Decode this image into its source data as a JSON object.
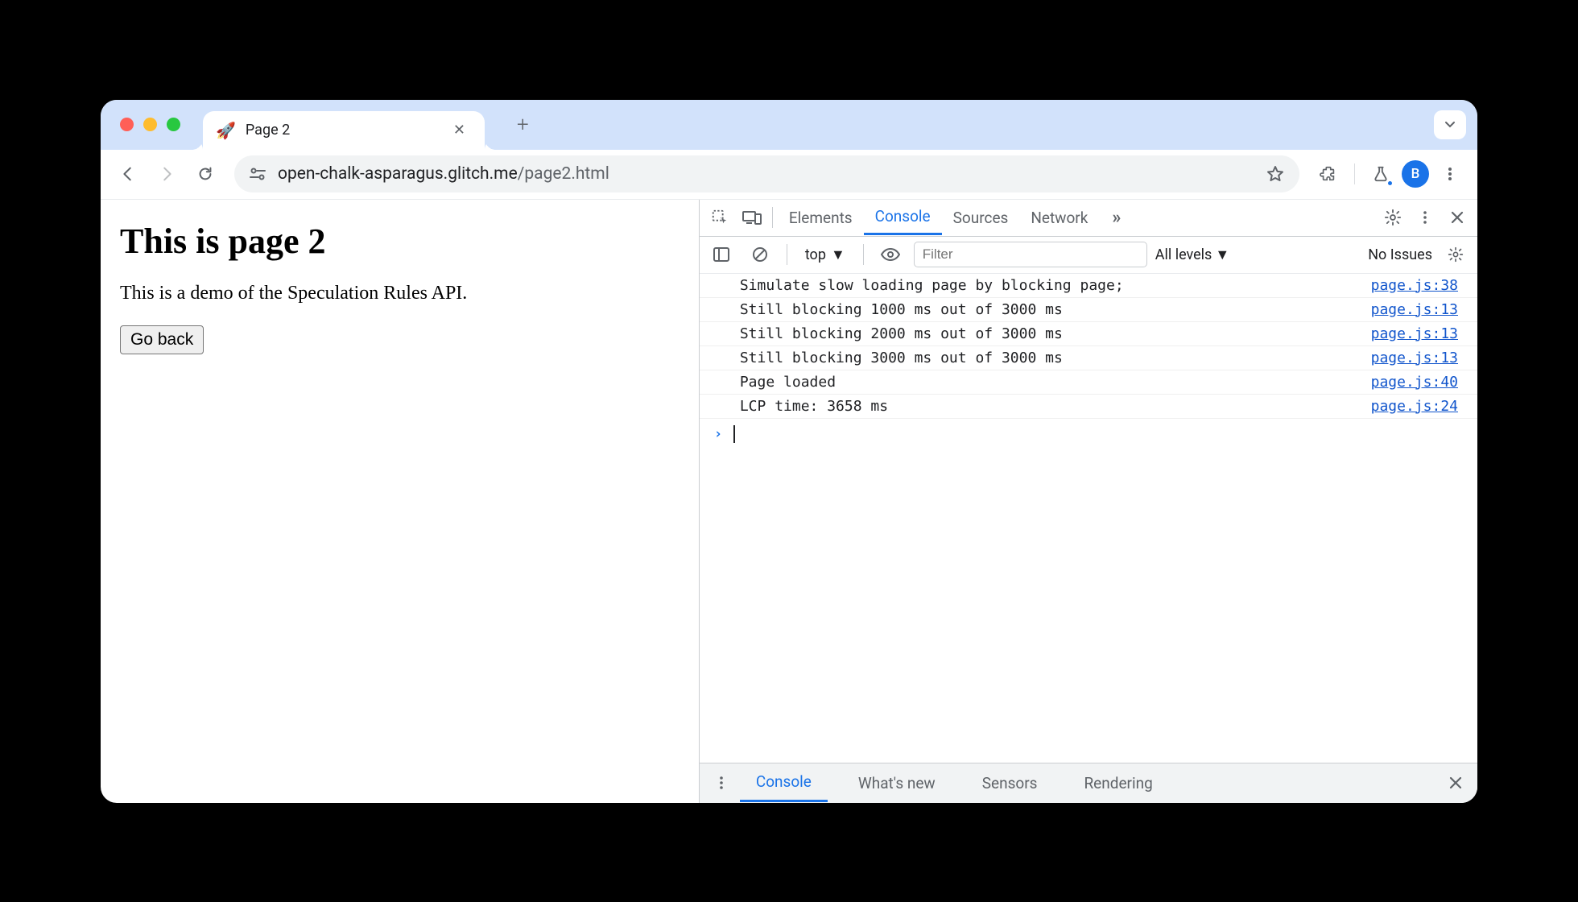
{
  "tab": {
    "title": "Page 2",
    "favicon": "🚀"
  },
  "url": {
    "host": "open-chalk-asparagus.glitch.me",
    "path": "/page2.html"
  },
  "avatar_letter": "B",
  "page": {
    "heading": "This is page 2",
    "body": "This is a demo of the Speculation Rules API.",
    "back_button": "Go back"
  },
  "devtools": {
    "tabs": [
      "Elements",
      "Console",
      "Sources",
      "Network"
    ],
    "active_tab": "Console",
    "overflow": "»",
    "console_toolbar": {
      "context": "top",
      "filter_placeholder": "Filter",
      "levels": "All levels",
      "issues": "No Issues"
    },
    "log": [
      {
        "msg": "Simulate slow loading page by blocking page;",
        "src": "page.js:38"
      },
      {
        "msg": "Still blocking 1000 ms out of 3000 ms",
        "src": "page.js:13"
      },
      {
        "msg": "Still blocking 2000 ms out of 3000 ms",
        "src": "page.js:13"
      },
      {
        "msg": "Still blocking 3000 ms out of 3000 ms",
        "src": "page.js:13"
      },
      {
        "msg": "Page loaded",
        "src": "page.js:40"
      },
      {
        "msg": "LCP time: 3658 ms",
        "src": "page.js:24"
      }
    ],
    "drawer_tabs": [
      "Console",
      "What's new",
      "Sensors",
      "Rendering"
    ],
    "drawer_active": "Console"
  }
}
